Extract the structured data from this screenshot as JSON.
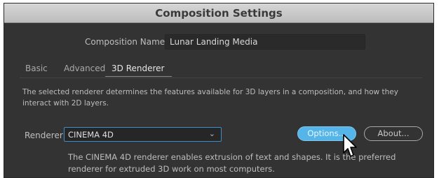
{
  "dialog": {
    "title": "Composition Settings",
    "composition_name_label": "Composition Name:",
    "composition_name_value": "Lunar Landing Media",
    "tabs": [
      {
        "label": "Basic",
        "active": false
      },
      {
        "label": "Advanced",
        "active": false
      },
      {
        "label": "3D Renderer",
        "active": true
      }
    ],
    "description": "The selected renderer determines the features available for 3D layers in a composition, and how they interact with 2D layers.",
    "renderer_label": "Renderer:",
    "renderer_value": "CINEMA 4D",
    "options_button": "Options...",
    "about_button": "About...",
    "renderer_description": "The CINEMA 4D renderer enables extrusion of text and shapes. It is the preferred renderer for extruded 3D work on most computers."
  },
  "colors": {
    "background": "#333333",
    "accent": "#55b4e8",
    "titlebar": "#c9c9c9"
  },
  "icons": {
    "dropdown": "chevron-down-icon",
    "pointer": "mouse-cursor-icon"
  }
}
